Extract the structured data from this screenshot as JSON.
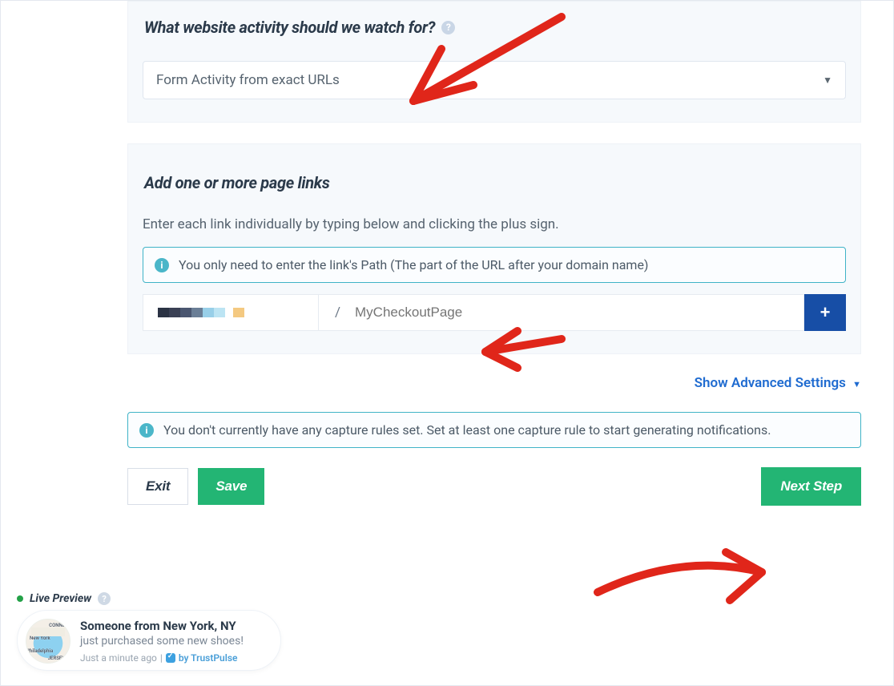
{
  "section1": {
    "heading": "What website activity should we watch for?",
    "select_value": "Form Activity from exact URLs"
  },
  "section2": {
    "heading": "Add one or more page links",
    "instruction": "Enter each link individually by typing below and clicking the plus sign.",
    "info": "You only need to enter the link's Path (The part of the URL after your domain name)",
    "slash": "/",
    "placeholder": "MyCheckoutPage"
  },
  "advanced_link": "Show Advanced Settings",
  "rules_info": "You don't currently have any capture rules set. Set at least one capture rule to start generating notifications.",
  "buttons": {
    "exit": "Exit",
    "save": "Save",
    "next": "Next Step"
  },
  "live_preview": {
    "title": "Live Preview",
    "headline": "Someone from New York, NY",
    "subline": "just purchased some new shoes!",
    "time": "Just a minute ago",
    "brand": "by TrustPulse",
    "map_labels": {
      "top": "CONNEC",
      "left": "New York",
      "mid": "Philadelphia",
      "bottom": "JERSEY"
    }
  }
}
